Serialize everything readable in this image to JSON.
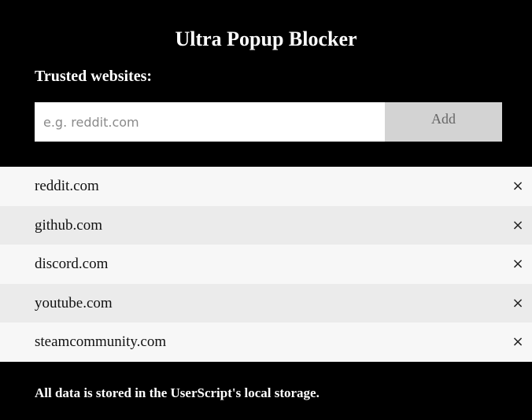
{
  "header": {
    "title": "Ultra Popup Blocker",
    "section_label": "Trusted websites:"
  },
  "add_form": {
    "input_value": "",
    "input_placeholder": "e.g. reddit.com",
    "add_label": "Add"
  },
  "trusted_sites": [
    {
      "domain": "reddit.com",
      "remove_icon": "close-icon",
      "remove_glyph": "×"
    },
    {
      "domain": "github.com",
      "remove_icon": "close-icon",
      "remove_glyph": "×"
    },
    {
      "domain": "discord.com",
      "remove_icon": "close-icon",
      "remove_glyph": "×"
    },
    {
      "domain": "youtube.com",
      "remove_icon": "close-icon",
      "remove_glyph": "×"
    },
    {
      "domain": "steamcommunity.com",
      "remove_icon": "close-icon",
      "remove_glyph": "×"
    }
  ],
  "footer": {
    "note": "All data is stored in the UserScript's local storage."
  },
  "colors": {
    "background": "#000000",
    "text_on_dark": "#ffffff",
    "row_light": "#f7f7f7",
    "row_alt": "#ebebeb",
    "button": "#d3d3d3"
  }
}
